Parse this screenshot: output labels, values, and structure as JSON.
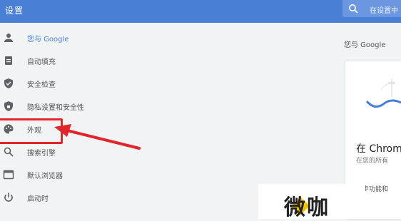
{
  "header": {
    "title": "设置",
    "search_placeholder": "在设置中"
  },
  "sidebar": {
    "items": [
      {
        "label": "您与 Google",
        "icon": "person-icon"
      },
      {
        "label": "自动填充",
        "icon": "clipboard-icon"
      },
      {
        "label": "安全检查",
        "icon": "shield-icon"
      },
      {
        "label": "隐私设置和安全性",
        "icon": "shield-lock-icon"
      },
      {
        "label": "外观",
        "icon": "palette-icon"
      },
      {
        "label": "搜索引擎",
        "icon": "search-icon"
      },
      {
        "label": "默认浏览器",
        "icon": "browser-icon"
      },
      {
        "label": "启动时",
        "icon": "power-icon"
      }
    ]
  },
  "main": {
    "section_title": "您与 Google",
    "card_heading": "在 Chrom",
    "card_subtext": "在您的所有",
    "card_sync": "同步功能和"
  },
  "watermark": {
    "text": "微咖"
  },
  "colors": {
    "header": "#4a7fd6",
    "highlight": "#e2242b",
    "accent": "#4a7fd6"
  }
}
